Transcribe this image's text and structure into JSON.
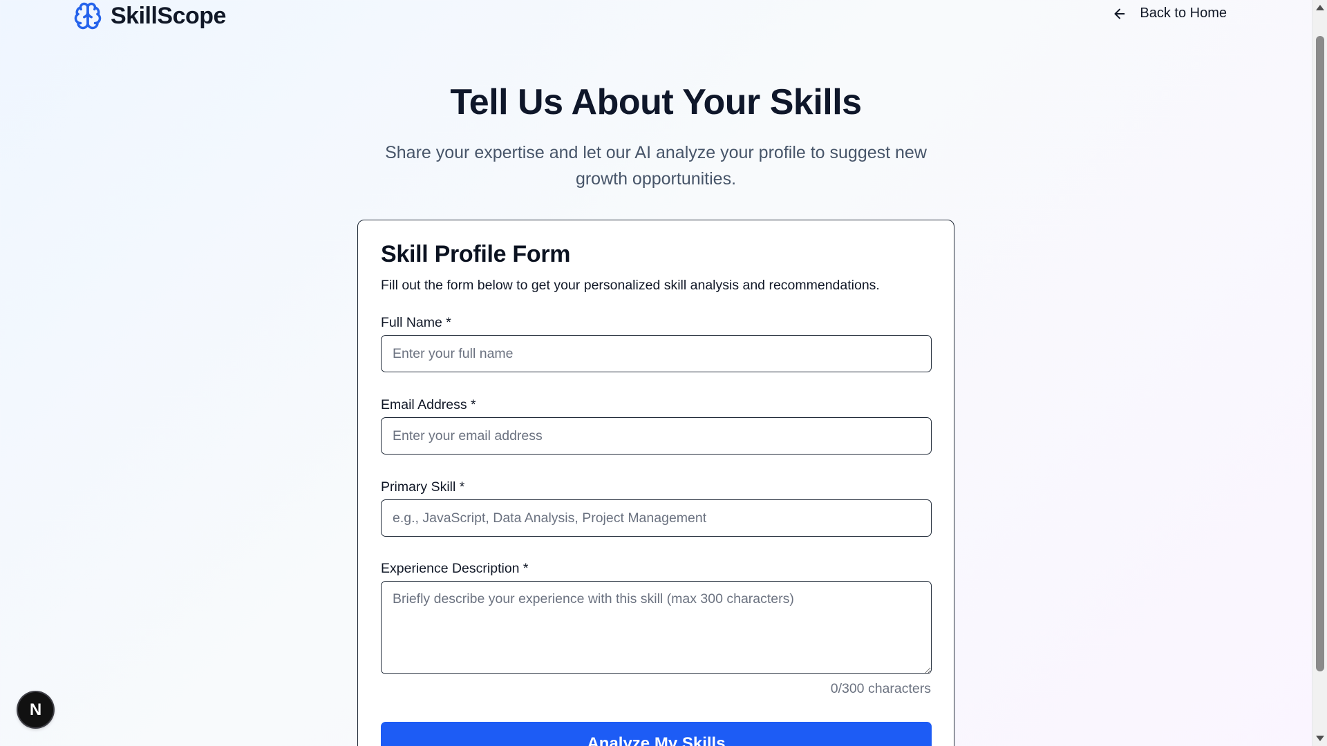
{
  "header": {
    "brand": "SkillScope",
    "back_label": "Back to Home",
    "logo_icon": "brain-icon",
    "back_icon": "arrow-left-icon"
  },
  "hero": {
    "title": "Tell Us About Your Skills",
    "subtitle": "Share your expertise and let our AI analyze your profile to suggest new growth opportunities."
  },
  "form": {
    "title": "Skill Profile Form",
    "description": "Fill out the form below to get your personalized skill analysis and recommendations.",
    "fields": {
      "full_name": {
        "label": "Full Name *",
        "placeholder": "Enter your full name",
        "value": ""
      },
      "email": {
        "label": "Email Address *",
        "placeholder": "Enter your email address",
        "value": ""
      },
      "primary_skill": {
        "label": "Primary Skill *",
        "placeholder": "e.g., JavaScript, Data Analysis, Project Management",
        "value": ""
      },
      "experience": {
        "label": "Experience Description *",
        "placeholder": "Briefly describe your experience with this skill (max 300 characters)",
        "value": ""
      }
    },
    "char_count": "0/300 characters",
    "submit_label": "Analyze My Skills"
  },
  "badge": {
    "label": "N"
  },
  "colors": {
    "accent": "#1d5cf5",
    "logo": "#2563eb",
    "text_primary": "#0f172a",
    "text_muted": "#475569"
  }
}
